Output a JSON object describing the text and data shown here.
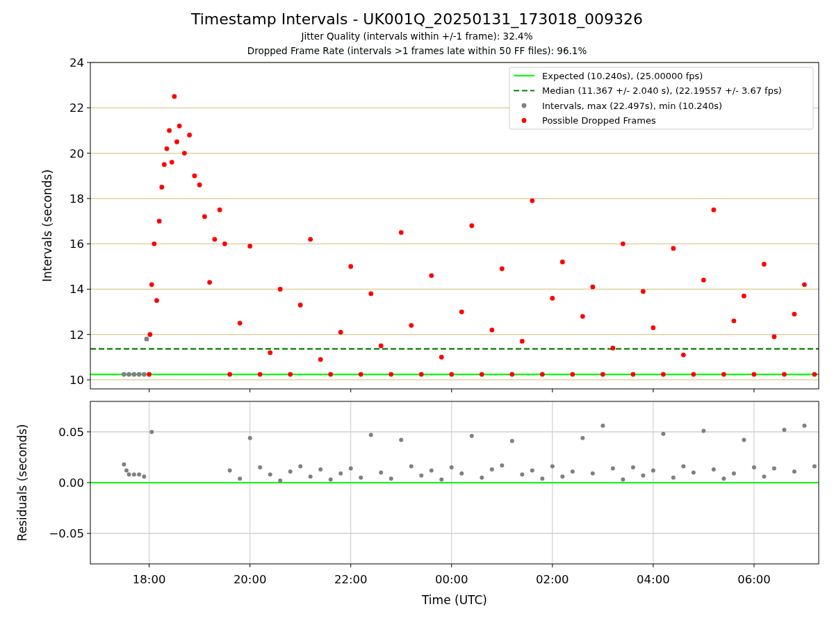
{
  "figure": {
    "title": "Timestamp Intervals - UK001Q_20250131_173018_009326",
    "subtitles": [
      "Jitter Quality (intervals within +/-1 frame): 32.4%",
      "Dropped Frame Rate (intervals >1 frames late within 50 FF files): 96.1%"
    ]
  },
  "intervals_plot": {
    "chart_data": {
      "type": "scatter",
      "ylabel": "Intervals (seconds)",
      "grid": true,
      "xlim": [
        "2025-01-31T16:50",
        "2025-02-01T07:17"
      ],
      "ylim": [
        9.6,
        24
      ],
      "yticks": [
        10,
        12,
        14,
        16,
        18,
        20,
        22,
        24
      ],
      "legend": true,
      "ref_lines": [
        {
          "axis": "y",
          "value": 10.24,
          "label": "Expected (10.240s), (25.00000 fps)",
          "color": "#00ff00"
        },
        {
          "axis": "y",
          "value": 11.367,
          "label": "Median (11.367 +/- 2.040 s), (22.19557 +/- 3.67 fps)",
          "color": "#008000"
        }
      ],
      "series": [
        {
          "name": "Intervals, max (22.497s), min (10.240s)",
          "color": "#808080",
          "x": [
            "2025-01-31T17:30",
            "2025-01-31T17:36",
            "2025-01-31T17:42",
            "2025-01-31T17:48",
            "2025-01-31T17:54",
            "2025-01-31T17:57"
          ],
          "values": [
            10.24,
            10.24,
            10.24,
            10.24,
            10.24,
            11.8
          ]
        },
        {
          "name": "Possible Dropped Frames",
          "color": "#ff0000",
          "x": [
            "2025-01-31T18:00",
            "2025-01-31T18:01",
            "2025-01-31T18:03",
            "2025-01-31T18:06",
            "2025-01-31T18:09",
            "2025-01-31T18:12",
            "2025-01-31T18:15",
            "2025-01-31T18:18",
            "2025-01-31T18:21",
            "2025-01-31T18:24",
            "2025-01-31T18:27",
            "2025-01-31T18:30",
            "2025-01-31T18:33",
            "2025-01-31T18:36",
            "2025-01-31T18:42",
            "2025-01-31T18:48",
            "2025-01-31T18:54",
            "2025-01-31T19:00",
            "2025-01-31T19:06",
            "2025-01-31T19:12",
            "2025-01-31T19:18",
            "2025-01-31T19:24",
            "2025-01-31T19:30",
            "2025-01-31T19:36",
            "2025-01-31T19:48",
            "2025-01-31T20:00",
            "2025-01-31T20:12",
            "2025-01-31T20:24",
            "2025-01-31T20:36",
            "2025-01-31T20:48",
            "2025-01-31T21:00",
            "2025-01-31T21:12",
            "2025-01-31T21:24",
            "2025-01-31T21:36",
            "2025-01-31T21:48",
            "2025-01-31T22:00",
            "2025-01-31T22:12",
            "2025-01-31T22:24",
            "2025-01-31T22:36",
            "2025-01-31T22:48",
            "2025-01-31T23:00",
            "2025-01-31T23:12",
            "2025-01-31T23:24",
            "2025-01-31T23:36",
            "2025-01-31T23:48",
            "2025-02-01T00:00",
            "2025-02-01T00:12",
            "2025-02-01T00:24",
            "2025-02-01T00:36",
            "2025-02-01T00:48",
            "2025-02-01T01:00",
            "2025-02-01T01:12",
            "2025-02-01T01:24",
            "2025-02-01T01:36",
            "2025-02-01T01:48",
            "2025-02-01T02:00",
            "2025-02-01T02:12",
            "2025-02-01T02:24",
            "2025-02-01T02:36",
            "2025-02-01T02:48",
            "2025-02-01T03:00",
            "2025-02-01T03:12",
            "2025-02-01T03:24",
            "2025-02-01T03:36",
            "2025-02-01T03:48",
            "2025-02-01T04:00",
            "2025-02-01T04:12",
            "2025-02-01T04:24",
            "2025-02-01T04:36",
            "2025-02-01T04:48",
            "2025-02-01T05:00",
            "2025-02-01T05:12",
            "2025-02-01T05:24",
            "2025-02-01T05:36",
            "2025-02-01T05:48",
            "2025-02-01T06:00",
            "2025-02-01T06:12",
            "2025-02-01T06:24",
            "2025-02-01T06:36",
            "2025-02-01T06:48",
            "2025-02-01T07:00",
            "2025-02-01T07:12"
          ],
          "values": [
            10.24,
            12.0,
            14.2,
            16.0,
            13.5,
            17.0,
            18.5,
            19.5,
            20.2,
            21.0,
            19.6,
            22.5,
            20.5,
            21.2,
            20.0,
            20.8,
            19.0,
            18.6,
            17.2,
            14.3,
            16.2,
            17.5,
            16.0,
            10.24,
            12.5,
            15.9,
            10.24,
            11.2,
            14.0,
            10.24,
            13.3,
            16.2,
            10.9,
            10.24,
            12.1,
            15.0,
            10.24,
            13.8,
            11.5,
            10.24,
            16.5,
            12.4,
            10.24,
            14.6,
            11.0,
            10.24,
            13.0,
            16.8,
            10.24,
            12.2,
            14.9,
            10.24,
            11.7,
            17.9,
            10.24,
            13.6,
            15.2,
            10.24,
            12.8,
            14.1,
            10.24,
            11.4,
            16.0,
            10.24,
            13.9,
            12.3,
            10.24,
            15.8,
            11.1,
            10.24,
            14.4,
            17.5,
            10.24,
            12.6,
            13.7,
            10.24,
            15.1,
            11.9,
            10.24,
            12.9,
            14.2,
            10.24
          ]
        }
      ]
    }
  },
  "residuals_plot": {
    "chart_data": {
      "type": "scatter",
      "xlabel": "Time (UTC)",
      "ylabel": "Residuals (seconds)",
      "grid": true,
      "xlim": [
        "2025-01-31T16:50",
        "2025-02-01T07:17"
      ],
      "ylim": [
        -0.08,
        0.08
      ],
      "xticks": [
        {
          "value": "2025-01-31T18:00",
          "label": "18:00"
        },
        {
          "value": "2025-01-31T20:00",
          "label": "20:00"
        },
        {
          "value": "2025-01-31T22:00",
          "label": "22:00"
        },
        {
          "value": "2025-02-01T00:00",
          "label": "00:00"
        },
        {
          "value": "2025-02-01T02:00",
          "label": "02:00"
        },
        {
          "value": "2025-02-01T04:00",
          "label": "04:00"
        },
        {
          "value": "2025-02-01T06:00",
          "label": "06:00"
        }
      ],
      "yticks": [
        {
          "value": -0.05,
          "label": "−0.05"
        },
        {
          "value": 0,
          "label": "0.00"
        },
        {
          "value": 0.05,
          "label": "0.05"
        }
      ],
      "ref_lines": [
        {
          "axis": "y",
          "value": 0,
          "color": "#00ff00"
        }
      ],
      "series": [
        {
          "color": "#808080",
          "x": [
            "2025-01-31T17:30",
            "2025-01-31T17:33",
            "2025-01-31T17:36",
            "2025-01-31T17:42",
            "2025-01-31T17:48",
            "2025-01-31T17:54",
            "2025-01-31T18:03",
            "2025-01-31T19:36",
            "2025-01-31T19:48",
            "2025-01-31T20:00",
            "2025-01-31T20:12",
            "2025-01-31T20:24",
            "2025-01-31T20:36",
            "2025-01-31T20:48",
            "2025-01-31T21:00",
            "2025-01-31T21:12",
            "2025-01-31T21:24",
            "2025-01-31T21:36",
            "2025-01-31T21:48",
            "2025-01-31T22:00",
            "2025-01-31T22:12",
            "2025-01-31T22:24",
            "2025-01-31T22:36",
            "2025-01-31T22:48",
            "2025-01-31T23:00",
            "2025-01-31T23:12",
            "2025-01-31T23:24",
            "2025-01-31T23:36",
            "2025-01-31T23:48",
            "2025-02-01T00:00",
            "2025-02-01T00:12",
            "2025-02-01T00:24",
            "2025-02-01T00:36",
            "2025-02-01T00:48",
            "2025-02-01T01:00",
            "2025-02-01T01:12",
            "2025-02-01T01:24",
            "2025-02-01T01:36",
            "2025-02-01T01:48",
            "2025-02-01T02:00",
            "2025-02-01T02:12",
            "2025-02-01T02:24",
            "2025-02-01T02:36",
            "2025-02-01T02:48",
            "2025-02-01T03:00",
            "2025-02-01T03:12",
            "2025-02-01T03:24",
            "2025-02-01T03:36",
            "2025-02-01T03:48",
            "2025-02-01T04:00",
            "2025-02-01T04:12",
            "2025-02-01T04:24",
            "2025-02-01T04:36",
            "2025-02-01T04:48",
            "2025-02-01T05:00",
            "2025-02-01T05:12",
            "2025-02-01T05:24",
            "2025-02-01T05:36",
            "2025-02-01T05:48",
            "2025-02-01T06:00",
            "2025-02-01T06:12",
            "2025-02-01T06:24",
            "2025-02-01T06:36",
            "2025-02-01T06:48",
            "2025-02-01T07:00",
            "2025-02-01T07:12"
          ],
          "values": [
            0.018,
            0.012,
            0.008,
            0.008,
            0.008,
            0.006,
            0.05,
            0.012,
            0.004,
            0.044,
            0.015,
            0.008,
            0.002,
            0.011,
            0.016,
            0.006,
            0.013,
            0.003,
            0.009,
            0.014,
            0.005,
            0.047,
            0.01,
            0.004,
            0.042,
            0.016,
            0.007,
            0.012,
            0.003,
            0.015,
            0.009,
            0.046,
            0.005,
            0.013,
            0.017,
            0.041,
            0.008,
            0.012,
            0.004,
            0.016,
            0.006,
            0.011,
            0.044,
            0.009,
            0.056,
            0.014,
            0.003,
            0.015,
            0.007,
            0.012,
            0.048,
            0.005,
            0.016,
            0.01,
            0.051,
            0.013,
            0.004,
            0.009,
            0.042,
            0.015,
            0.006,
            0.014,
            0.052,
            0.011,
            0.056,
            0.016
          ]
        }
      ]
    }
  }
}
